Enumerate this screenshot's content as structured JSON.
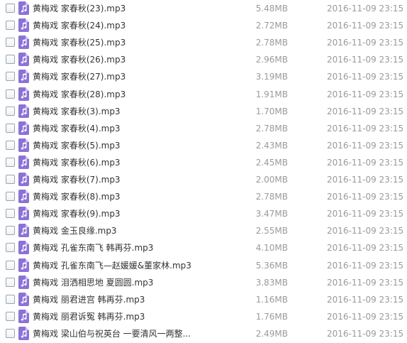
{
  "files": [
    {
      "name": "黄梅戏 家春秋(23).mp3",
      "size": "5.48MB",
      "date": "2016-11-09 23:15"
    },
    {
      "name": "黄梅戏 家春秋(24).mp3",
      "size": "2.72MB",
      "date": "2016-11-09 23:15"
    },
    {
      "name": "黄梅戏 家春秋(25).mp3",
      "size": "2.78MB",
      "date": "2016-11-09 23:15"
    },
    {
      "name": "黄梅戏 家春秋(26).mp3",
      "size": "2.96MB",
      "date": "2016-11-09 23:15"
    },
    {
      "name": "黄梅戏 家春秋(27).mp3",
      "size": "3.19MB",
      "date": "2016-11-09 23:15"
    },
    {
      "name": "黄梅戏 家春秋(28).mp3",
      "size": "1.91MB",
      "date": "2016-11-09 23:15"
    },
    {
      "name": "黄梅戏 家春秋(3).mp3",
      "size": "1.70MB",
      "date": "2016-11-09 23:15"
    },
    {
      "name": "黄梅戏 家春秋(4).mp3",
      "size": "2.78MB",
      "date": "2016-11-09 23:15"
    },
    {
      "name": "黄梅戏 家春秋(5).mp3",
      "size": "2.43MB",
      "date": "2016-11-09 23:15"
    },
    {
      "name": "黄梅戏 家春秋(6).mp3",
      "size": "2.45MB",
      "date": "2016-11-09 23:15"
    },
    {
      "name": "黄梅戏 家春秋(7).mp3",
      "size": "2.00MB",
      "date": "2016-11-09 23:15"
    },
    {
      "name": "黄梅戏 家春秋(8).mp3",
      "size": "2.78MB",
      "date": "2016-11-09 23:15"
    },
    {
      "name": "黄梅戏 家春秋(9).mp3",
      "size": "3.47MB",
      "date": "2016-11-09 23:15"
    },
    {
      "name": "黄梅戏 金玉良缘.mp3",
      "size": "2.55MB",
      "date": "2016-11-09 23:15"
    },
    {
      "name": "黄梅戏 孔雀东南飞 韩再芬.mp3",
      "size": "4.10MB",
      "date": "2016-11-09 23:15"
    },
    {
      "name": "黄梅戏 孔雀东南飞—赵媛媛&董家林.mp3",
      "size": "5.36MB",
      "date": "2016-11-09 23:15"
    },
    {
      "name": "黄梅戏 泪洒相思地 夏圆圆.mp3",
      "size": "3.83MB",
      "date": "2016-11-09 23:15"
    },
    {
      "name": "黄梅戏 丽君进宫 韩再芬.mp3",
      "size": "1.16MB",
      "date": "2016-11-09 23:15"
    },
    {
      "name": "黄梅戏 丽君诉冤 韩再芬.mp3",
      "size": "1.76MB",
      "date": "2016-11-09 23:15"
    },
    {
      "name": "黄梅戏 梁山伯与祝英台 一要清风一两整...",
      "size": "2.49MB",
      "date": "2016-11-09 23:15"
    }
  ],
  "icon": "music-file-icon",
  "colors": {
    "icon_bg": "#8c72d6",
    "name_text": "#333333",
    "meta_text": "#9a9a9a"
  }
}
